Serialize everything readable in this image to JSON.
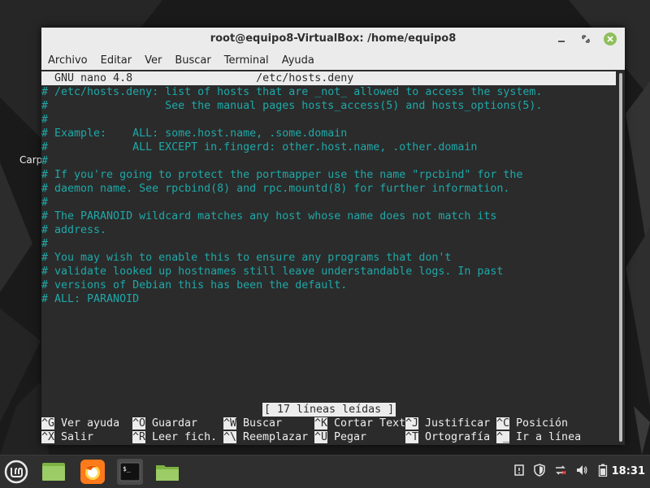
{
  "desktop": {
    "icon_label": "Carp"
  },
  "window": {
    "title": "root@equipo8-VirtualBox: /home/equipo8",
    "menu": [
      "Archivo",
      "Editar",
      "Ver",
      "Buscar",
      "Terminal",
      "Ayuda"
    ]
  },
  "nano": {
    "header": "  GNU nano 4.8                   /etc/hosts.deny",
    "lines": [
      "# /etc/hosts.deny: list of hosts that are _not_ allowed to access the system.",
      "#                  See the manual pages hosts_access(5) and hosts_options(5).",
      "#",
      "# Example:    ALL: some.host.name, .some.domain",
      "#             ALL EXCEPT in.fingerd: other.host.name, .other.domain",
      "#",
      "# If you're going to protect the portmapper use the name \"rpcbind\" for the",
      "# daemon name. See rpcbind(8) and rpc.mountd(8) for further information.",
      "#",
      "# The PARANOID wildcard matches any host whose name does not match its",
      "# address.",
      "#",
      "# You may wish to enable this to ensure any programs that don't",
      "# validate looked up hostnames still leave understandable logs. In past",
      "# versions of Debian this has been the default.",
      "# ALL: PARANOID"
    ],
    "status": "[ 17 líneas leídas ]",
    "shortcuts_row1": [
      {
        "key": "^G",
        "label": " Ver ayuda"
      },
      {
        "key": "^O",
        "label": " Guardar"
      },
      {
        "key": "^W",
        "label": " Buscar"
      },
      {
        "key": "^K",
        "label": " Cortar Text"
      },
      {
        "key": "^J",
        "label": " Justificar"
      },
      {
        "key": "^C",
        "label": " Posición"
      }
    ],
    "shortcuts_row2": [
      {
        "key": "^X",
        "label": " Salir"
      },
      {
        "key": "^R",
        "label": " Leer fich."
      },
      {
        "key": "^\\",
        "label": " Reemplazar"
      },
      {
        "key": "^U",
        "label": " Pegar"
      },
      {
        "key": "^T",
        "label": " Ortografía"
      },
      {
        "key": "^_",
        "label": " Ir a línea"
      }
    ]
  },
  "taskbar": {
    "clock": "18:31",
    "icons": [
      "mint-menu-icon",
      "show-desktop-icon",
      "firefox-icon",
      "terminal-icon",
      "files-icon"
    ],
    "tray_icons": [
      "notification-icon",
      "shield-icon",
      "network-icon",
      "volume-icon",
      "battery-icon"
    ]
  },
  "colors": {
    "comment": "#1fa8a8",
    "terminal_bg": "#2b2b2b",
    "titlebar": "#ebebeb",
    "close_button": "#8fbf5a"
  }
}
